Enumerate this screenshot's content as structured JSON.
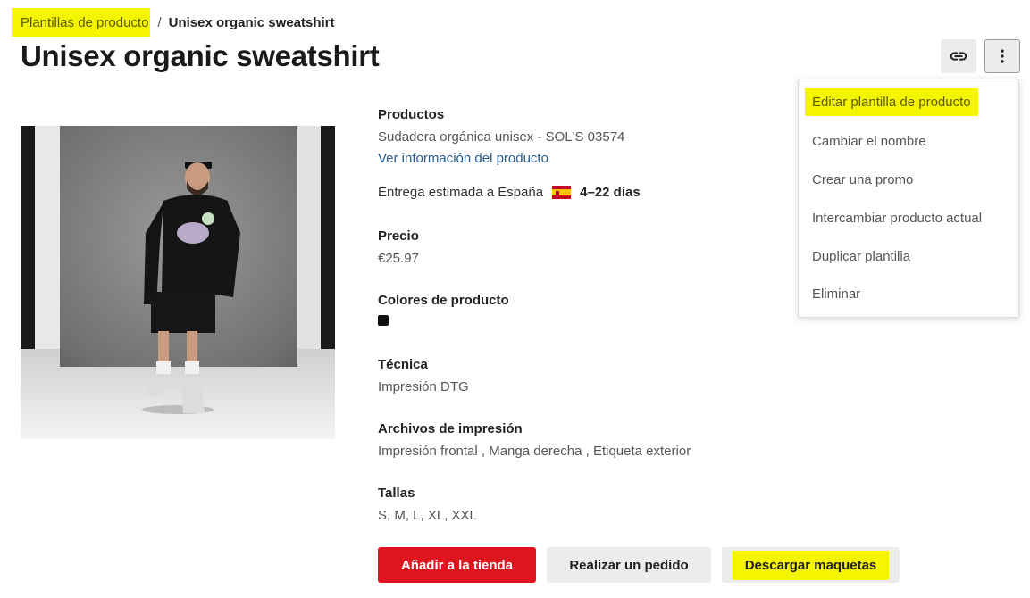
{
  "breadcrumb": {
    "parent": "Plantillas de producto",
    "separator": "/",
    "current": "Unisex organic sweatshirt"
  },
  "page_title": "Unisex organic sweatshirt",
  "toolbar": {
    "link_icon": "link-icon",
    "more_icon": "more-vertical-icon"
  },
  "product": {
    "products_title": "Productos",
    "product_name": "Sudadera orgánica unisex - SOL'S 03574",
    "info_link": "Ver información del producto",
    "delivery_label": "Entrega estimada a España",
    "delivery_flag": "spain-flag-icon",
    "delivery_days": "4–22 días",
    "price_title": "Precio",
    "price": "€25.97",
    "colors_title": "Colores de producto",
    "color_swatch": "#111111",
    "technique_title": "Técnica",
    "technique": "Impresión DTG",
    "files_title": "Archivos de impresión",
    "files": "Impresión frontal , Manga derecha , Etiqueta exterior",
    "sizes_title": "Tallas",
    "sizes": "S, M, L, XL, XXL"
  },
  "actions": {
    "add_to_store": "Añadir a la tienda",
    "place_order": "Realizar un pedido",
    "download_mockups": "Descargar maquetas"
  },
  "menu": {
    "items": [
      "Editar plantilla de producto",
      "Cambiar el nombre",
      "Crear una promo",
      "Intercambiar producto actual",
      "Duplicar plantilla",
      "Eliminar"
    ]
  },
  "colors": {
    "accent_red": "#e0141e",
    "highlight_yellow": "#f5f500",
    "link_blue": "#2a5d8f"
  }
}
